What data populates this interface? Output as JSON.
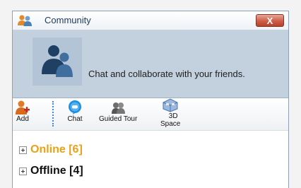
{
  "window": {
    "title": "Community",
    "close_label": "X"
  },
  "banner": {
    "text": "Chat and collaborate with your friends."
  },
  "toolbar": {
    "items": [
      {
        "label": "Add",
        "icon": "add-user-icon"
      },
      {
        "label": "Chat",
        "icon": "chat-icon"
      },
      {
        "label": "Guided Tour",
        "icon": "guided-tour-icon"
      },
      {
        "label_line1": "3D",
        "label_line2": "Space",
        "icon": "3d-space-icon"
      }
    ]
  },
  "groups": [
    {
      "label": "Online [6]",
      "color": "#e8a21a"
    },
    {
      "label": "Offline [4]",
      "color": "#111111"
    }
  ],
  "colors": {
    "banner_bg": "#c3d1df",
    "online": "#e8a21a",
    "close_button": "#cd5d47"
  }
}
